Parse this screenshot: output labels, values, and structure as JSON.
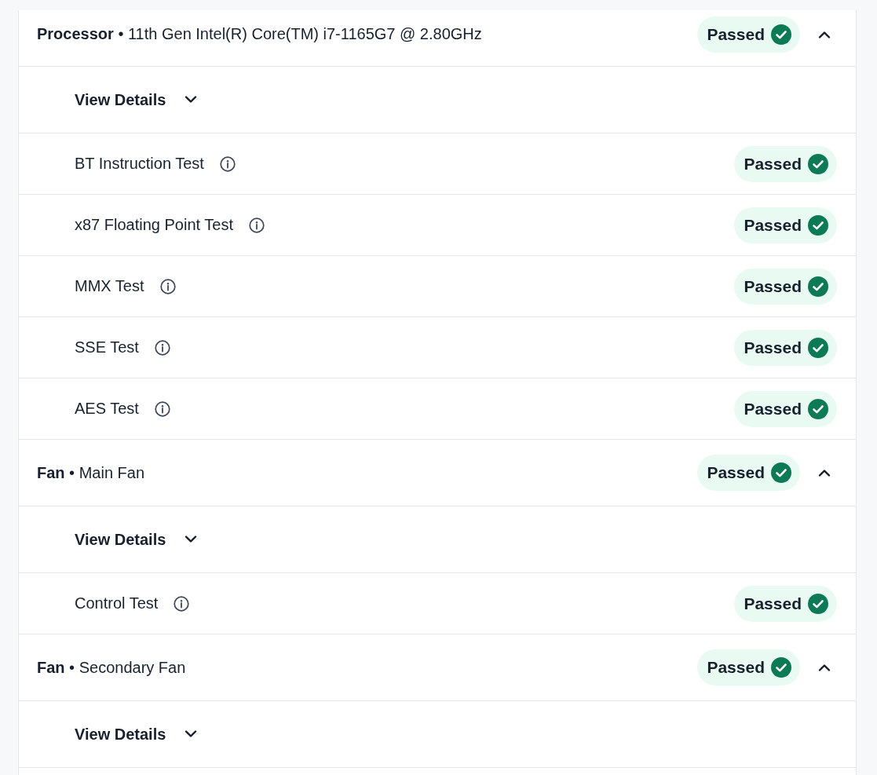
{
  "components": [
    {
      "title": "**Processor** • 11th Gen Intel(R) Core(TM) i7-1165G7 @ 2.80GHz",
      "status": {
        "text": "Passed",
        "kind": "passed"
      },
      "expanded": true,
      "details": {
        "label": "View Details",
        "expanded": false
      },
      "tests": [
        {
          "name": "BT Instruction Test",
          "status": {
            "text": "Passed",
            "kind": "passed"
          }
        },
        {
          "name": "x87 Floating Point Test",
          "status": {
            "text": "Passed",
            "kind": "passed"
          }
        },
        {
          "name": "MMX Test",
          "status": {
            "text": "Passed",
            "kind": "passed"
          }
        },
        {
          "name": "SSE Test",
          "status": {
            "text": "Passed",
            "kind": "passed"
          }
        },
        {
          "name": "AES Test",
          "status": {
            "text": "Passed",
            "kind": "passed"
          }
        }
      ]
    },
    {
      "title": "**Fan** • Main Fan",
      "status": {
        "text": "Passed",
        "kind": "passed"
      },
      "expanded": true,
      "details": {
        "label": "View Details",
        "expanded": false
      },
      "tests": [
        {
          "name": "Control Test",
          "status": {
            "text": "Passed",
            "kind": "passed"
          }
        }
      ]
    },
    {
      "title": "**Fan** • Secondary Fan",
      "status": {
        "text": "Passed",
        "kind": "passed"
      },
      "expanded": true,
      "details": {
        "label": "View Details",
        "expanded": false
      }
    }
  ]
}
